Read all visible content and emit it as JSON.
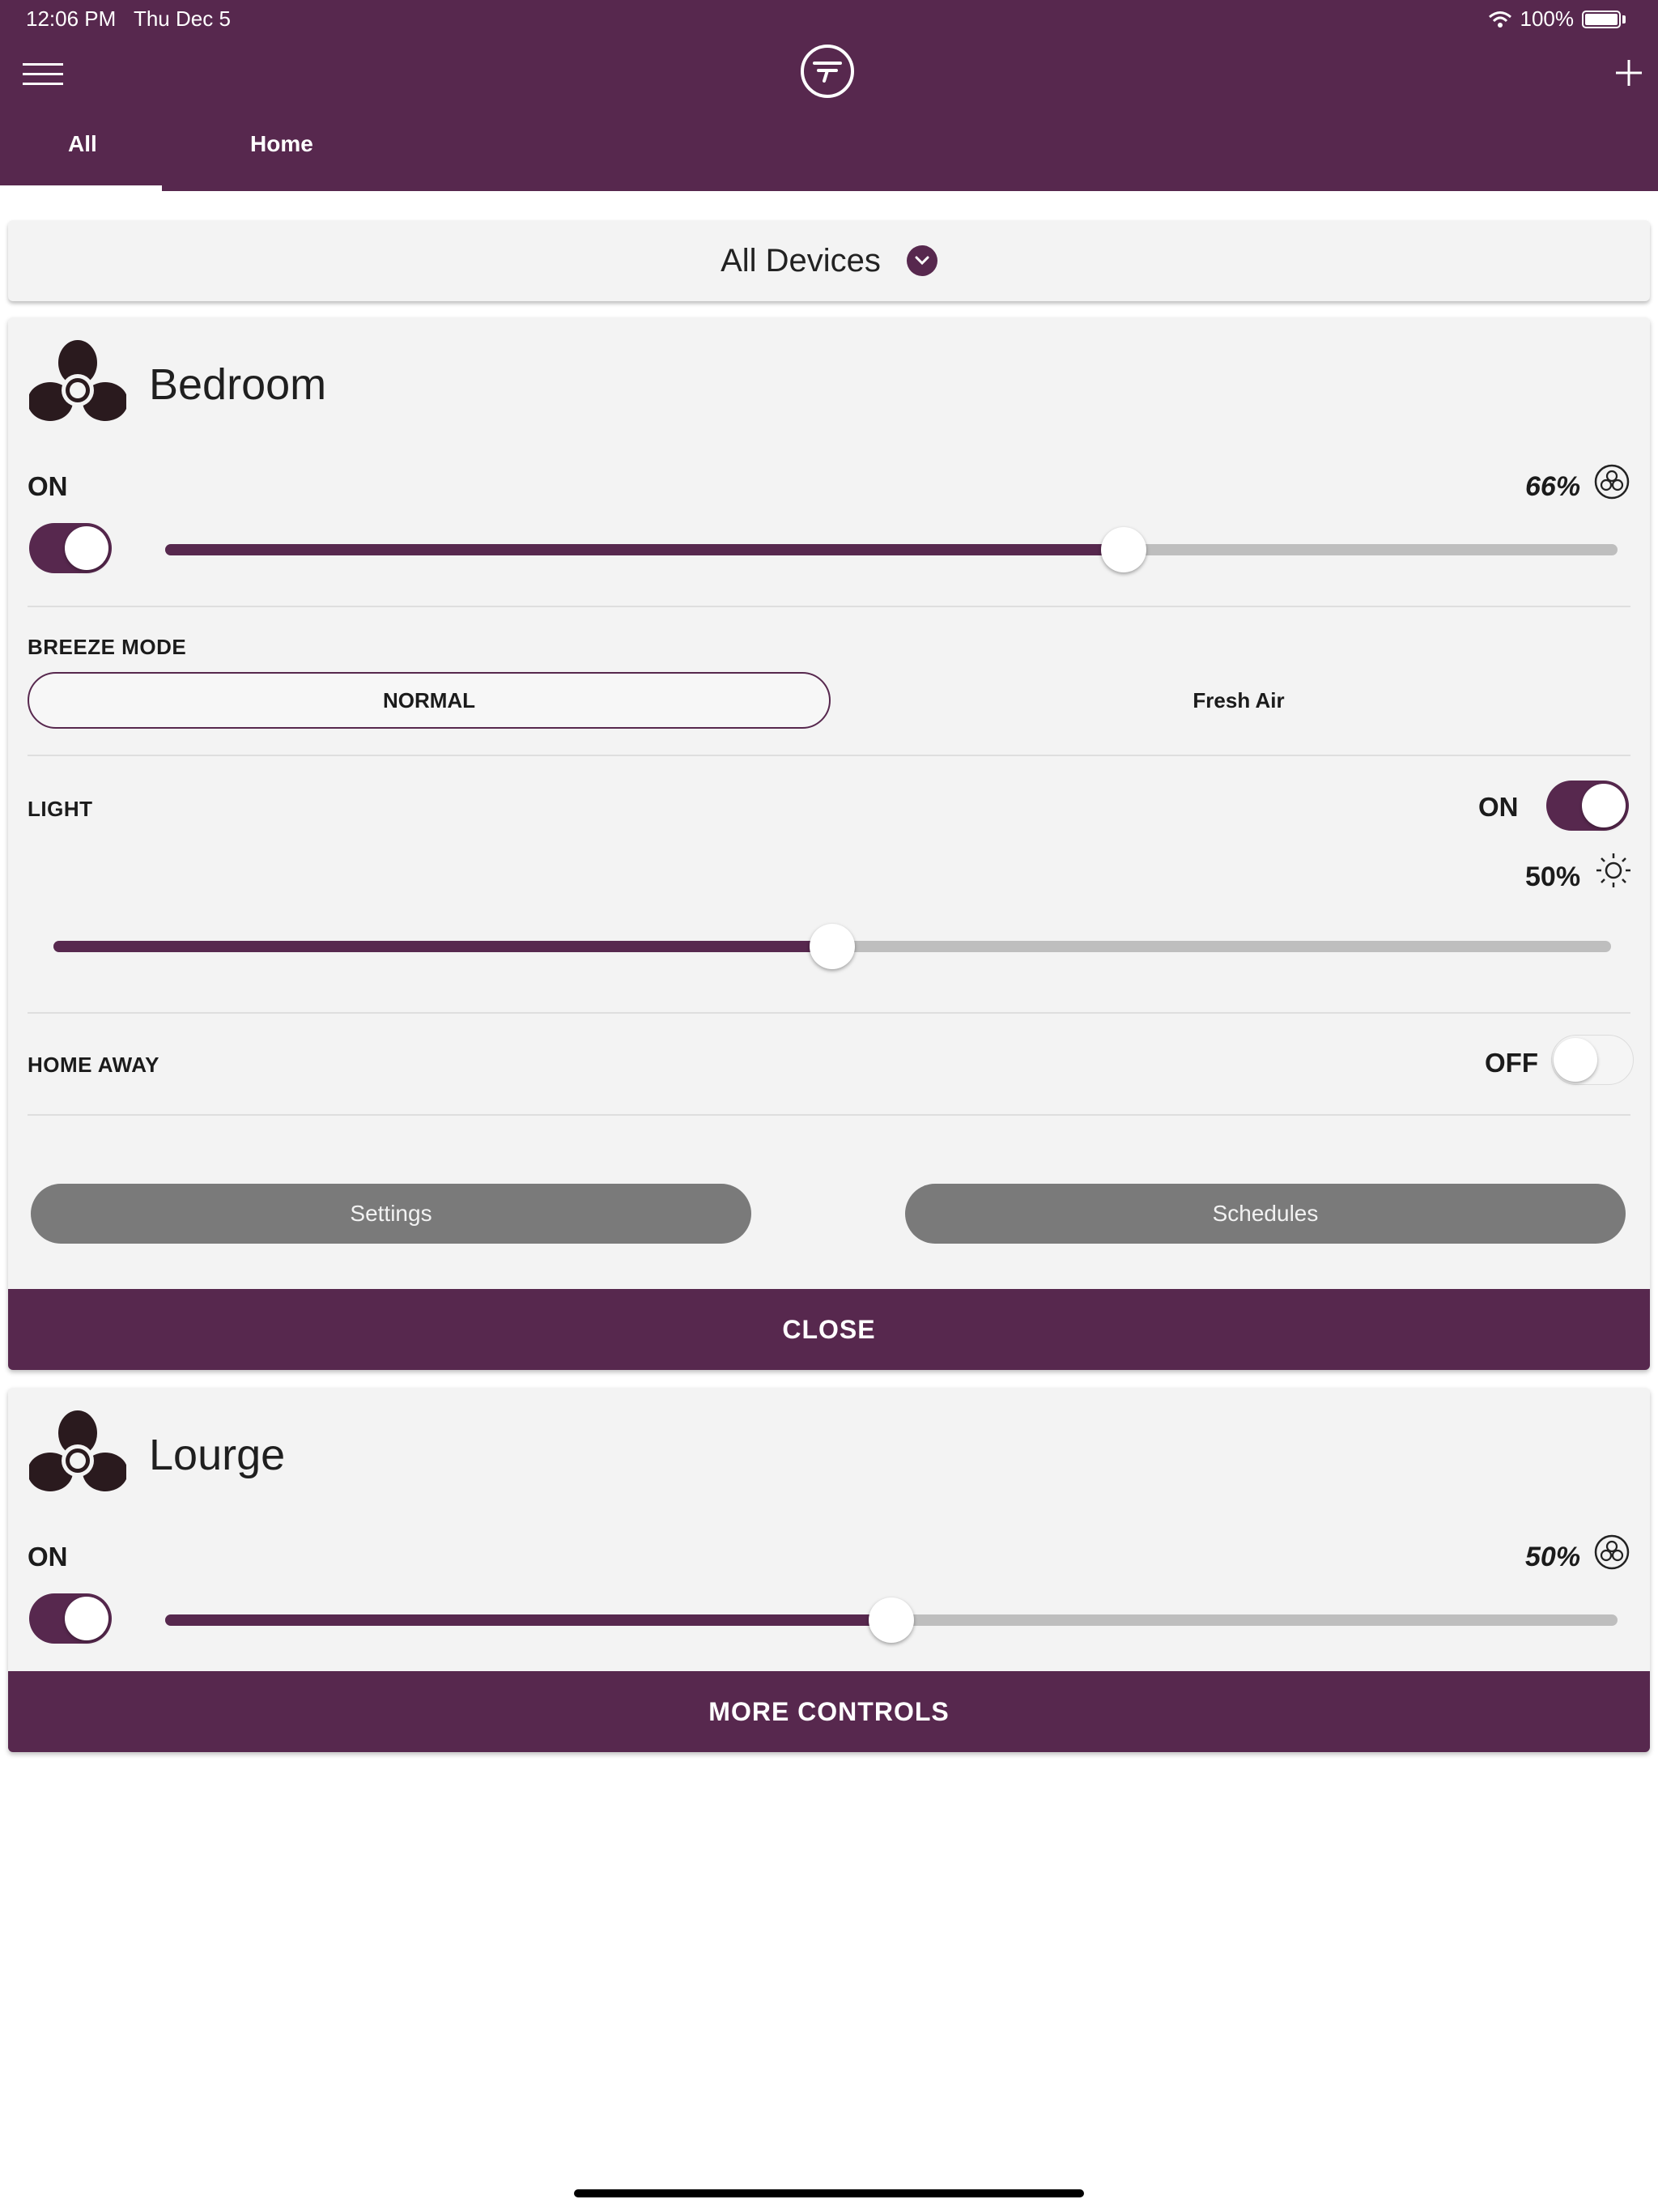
{
  "status_bar": {
    "time": "12:06 PM",
    "date": "Thu Dec 5",
    "battery": "100%"
  },
  "header": {
    "tabs": [
      {
        "label": "All",
        "selected": true
      },
      {
        "label": "Home",
        "selected": false
      }
    ]
  },
  "filter": {
    "label": "All Devices"
  },
  "bedroom": {
    "name": "Bedroom",
    "fan_state": "ON",
    "fan_speed_label": "66%",
    "fan_speed": 66,
    "breeze_mode_label": "BREEZE MODE",
    "modes": [
      {
        "label": "NORMAL",
        "selected": true
      },
      {
        "label": "Fresh Air",
        "selected": false
      }
    ],
    "light_label": "LIGHT",
    "light_state": "ON",
    "light_level_label": "50%",
    "light_level": 50,
    "home_away_label": "HOME AWAY",
    "home_away_state": "OFF",
    "settings_label": "Settings",
    "schedules_label": "Schedules",
    "close_label": "CLOSE"
  },
  "lounge": {
    "name": "Lourge",
    "fan_state": "ON",
    "fan_speed_label": "50%",
    "fan_speed": 50,
    "more_label": "MORE CONTROLS"
  },
  "colors": {
    "brand": "#57284e",
    "track": "#bebebe",
    "card": "#f3f3f3",
    "button_gray": "#7a7a7a"
  },
  "icons": [
    "menu-icon",
    "logo-icon",
    "plus-icon",
    "wifi-icon",
    "battery-icon",
    "chevron-down-icon",
    "fan-icon",
    "fan-speed-icon",
    "sun-icon"
  ]
}
